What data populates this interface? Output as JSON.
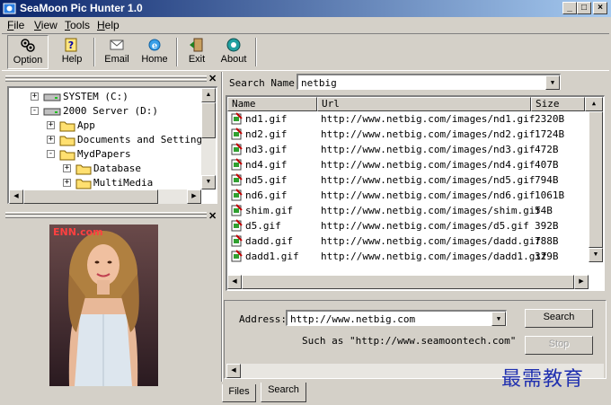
{
  "window": {
    "title": "SeaMoon Pic Hunter 1.0",
    "controls": [
      "_",
      "□",
      "×"
    ]
  },
  "menu": [
    {
      "label": "File",
      "u": "F",
      "rest": "ile"
    },
    {
      "label": "View",
      "u": "V",
      "rest": "iew"
    },
    {
      "label": "Tools",
      "u": "T",
      "rest": "ools"
    },
    {
      "label": "Help",
      "u": "H",
      "rest": "elp"
    }
  ],
  "toolbar": {
    "option": "Option",
    "help": "Help",
    "email": "Email",
    "home": "Home",
    "exit": "Exit",
    "about": "About"
  },
  "tree": {
    "nodes": [
      {
        "label": "SYSTEM (C:)",
        "type": "drive",
        "expander": "+"
      },
      {
        "label": "2000 Server (D:)",
        "type": "drive",
        "expander": "-"
      },
      {
        "label": "App",
        "type": "folder",
        "expander": "+"
      },
      {
        "label": "Documents and Settings",
        "type": "folder",
        "expander": "+"
      },
      {
        "label": "MydPapers",
        "type": "folder",
        "expander": "-"
      },
      {
        "label": "Database",
        "type": "folder",
        "expander": "+"
      },
      {
        "label": "MultiMedia",
        "type": "folder",
        "expander": "+"
      }
    ]
  },
  "preview": {
    "watermark": "ENN.com"
  },
  "search": {
    "label": "Search Name:",
    "value": "netbig"
  },
  "table": {
    "columns": [
      "Name",
      "Url",
      "Size"
    ],
    "rows": [
      {
        "name": "nd1.gif",
        "url": "http://www.netbig.com/images/nd1.gif",
        "size": "2320B"
      },
      {
        "name": "nd2.gif",
        "url": "http://www.netbig.com/images/nd2.gif",
        "size": "1724B"
      },
      {
        "name": "nd3.gif",
        "url": "http://www.netbig.com/images/nd3.gif",
        "size": "472B"
      },
      {
        "name": "nd4.gif",
        "url": "http://www.netbig.com/images/nd4.gif",
        "size": "407B"
      },
      {
        "name": "nd5.gif",
        "url": "http://www.netbig.com/images/nd5.gif",
        "size": "794B"
      },
      {
        "name": "nd6.gif",
        "url": "http://www.netbig.com/images/nd6.gif",
        "size": "1061B"
      },
      {
        "name": "shim.gif",
        "url": "http://www.netbig.com/images/shim.gif",
        "size": "54B"
      },
      {
        "name": "d5.gif",
        "url": "http://www.netbig.com/images/d5.gif",
        "size": "392B"
      },
      {
        "name": "dadd.gif",
        "url": "http://www.netbig.com/images/dadd.gif",
        "size": "788B"
      },
      {
        "name": "dadd1.gif",
        "url": "http://www.netbig.com/images/dadd1.gif",
        "size": "329B"
      }
    ]
  },
  "address": {
    "label": "Address:",
    "value": "http://www.netbig.com",
    "hint": "Such as \"http://www.seamoontech.com\"",
    "search_button": "Search",
    "stop_button": "Stop"
  },
  "tabs": [
    "Files",
    "Search"
  ],
  "watermark_text": "最需教育"
}
